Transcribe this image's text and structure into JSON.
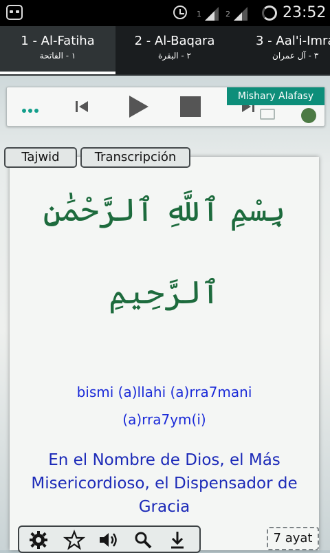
{
  "status_bar": {
    "time": "23:52",
    "sim1_label": "1",
    "sim2_label": "2"
  },
  "tabs": [
    {
      "title": "1 - Al-Fatiha",
      "subtitle": "١ - الفاتحة",
      "active": true
    },
    {
      "title": "2 - Al-Baqara",
      "subtitle": "٢ - البقرة",
      "active": false
    },
    {
      "title": "3 - Aal'i-Imra",
      "subtitle": "٣ - آل عمران",
      "active": false
    }
  ],
  "player": {
    "reciter": "Mishary Alafasy"
  },
  "modes": {
    "tajwid": "Tajwid",
    "transcription": "Transcripción"
  },
  "verse": {
    "arabic_line1": "بِسْمِ ٱللَّهِ ٱلرَّحْمَٰنِ",
    "arabic_line2": "ٱلرَّحِيمِ",
    "translit_line1": "bismi  (a)llahi  (a)rra7mani",
    "translit_line2": "(a)rra7ym(i)",
    "translation": "En el Nombre de Dios, el Más Misericordioso, el Dispensador de Gracia"
  },
  "footer": {
    "ayat_count": "7 ayat"
  },
  "colors": {
    "accent": "#0d8e7a",
    "arabic": "#1d6b3d",
    "translit": "#1a2ad8",
    "translation": "#1c2ab8"
  },
  "icons": [
    "settings-icon",
    "star-icon",
    "volume-icon",
    "search-icon",
    "download-icon"
  ]
}
